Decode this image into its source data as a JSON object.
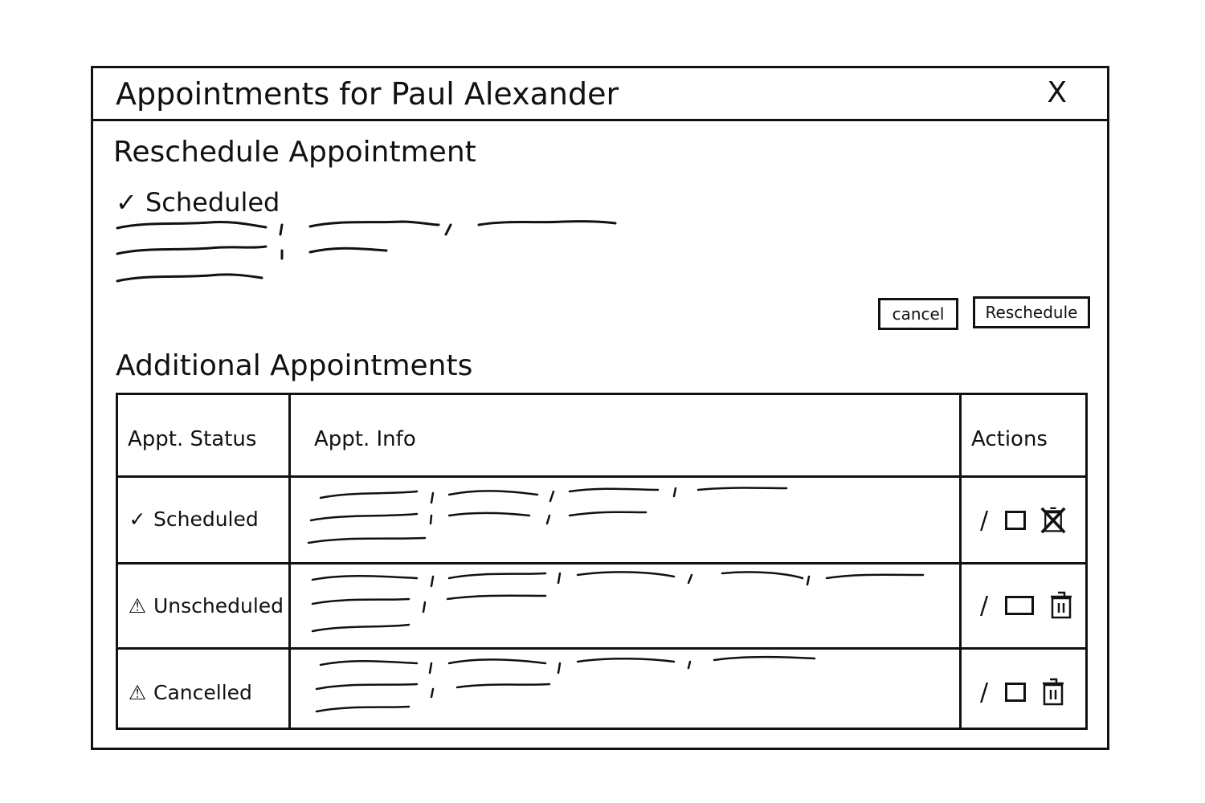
{
  "dialog": {
    "title": "Appointments for Paul Alexander",
    "close_label": "X"
  },
  "reschedule": {
    "heading": "Reschedule Appointment",
    "status_mark": "✓",
    "status": "Scheduled",
    "cancel_label": "cancel",
    "reschedule_label": "Reschedule"
  },
  "additional": {
    "heading": "Additional Appointments",
    "columns": [
      "Appt. Status",
      "Appt. Info",
      "Actions"
    ],
    "rows": [
      {
        "status_mark": "✓",
        "status": "Scheduled",
        "edit_icon": "/",
        "delete_icon": "trash-icon"
      },
      {
        "status_mark": "⚠",
        "status": "Unscheduled",
        "edit_icon": "/",
        "delete_icon": "trash-icon"
      },
      {
        "status_mark": "⚠",
        "status": "Cancelled",
        "edit_icon": "/",
        "delete_icon": "trash-icon"
      }
    ]
  }
}
